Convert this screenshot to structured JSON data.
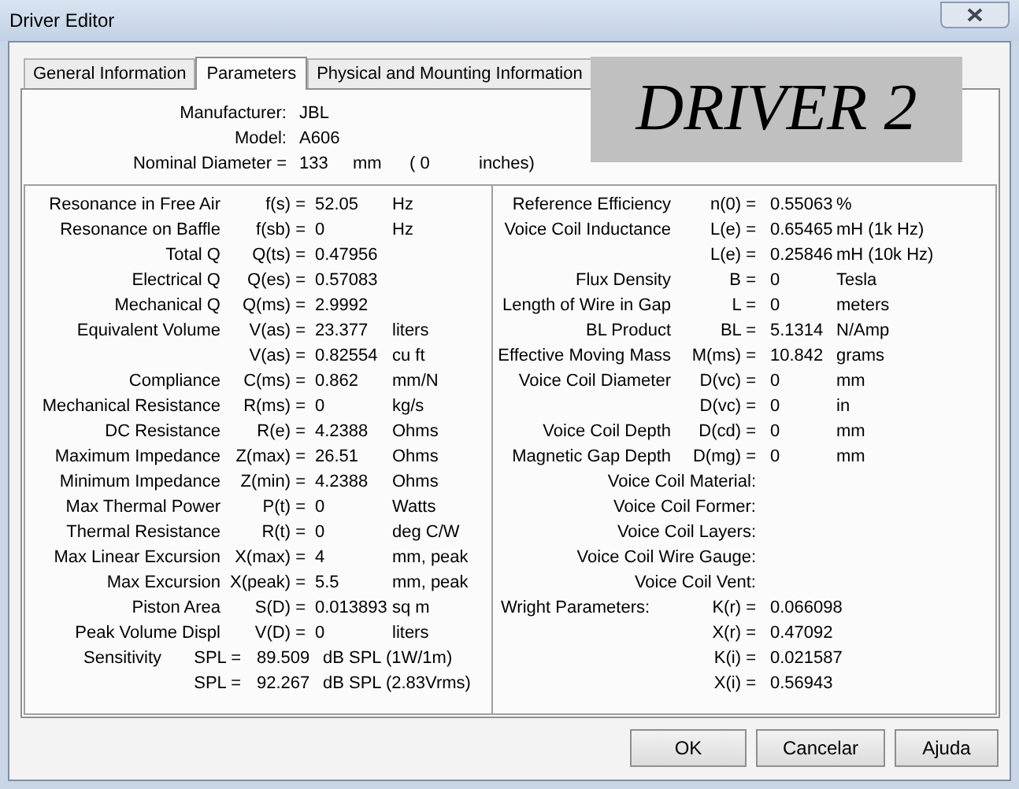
{
  "window": {
    "title": "Driver Editor"
  },
  "tabs": [
    {
      "label": "General Information",
      "selected": false
    },
    {
      "label": "Parameters",
      "selected": true
    },
    {
      "label": "Physical and Mounting Information",
      "selected": false
    }
  ],
  "banner": "DRIVER 2",
  "header": {
    "fields": [
      {
        "label": "Manufacturer:",
        "value": "JBL"
      },
      {
        "label": "Model:",
        "value": "A606"
      }
    ],
    "diameter": {
      "label": "Nominal Diameter =",
      "value": "133",
      "unit": "mm",
      "inches_value": "( 0",
      "inches_unit": "inches)"
    }
  },
  "left": [
    {
      "kind": "param",
      "label": "Resonance in Free Air",
      "symbol": "f(s) =",
      "value": "52.05",
      "unit": "Hz"
    },
    {
      "kind": "param",
      "label": "Resonance on Baffle",
      "symbol": "f(sb) =",
      "value": "0",
      "unit": "Hz"
    },
    {
      "kind": "param",
      "label": "Total Q",
      "symbol": "Q(ts) =",
      "value": "0.47956"
    },
    {
      "kind": "param",
      "label": "Electrical Q",
      "symbol": "Q(es) =",
      "value": "0.57083"
    },
    {
      "kind": "param",
      "label": "Mechanical Q",
      "symbol": "Q(ms) =",
      "value": "2.9992"
    },
    {
      "kind": "param",
      "label": "Equivalent Volume",
      "symbol": "V(as) =",
      "value": "23.377",
      "unit": "liters"
    },
    {
      "kind": "param",
      "symbol": "V(as) =",
      "value": "0.82554",
      "unit": "cu ft"
    },
    {
      "kind": "param",
      "label": "Compliance",
      "symbol": "C(ms) =",
      "value": "0.862",
      "unit": "mm/N"
    },
    {
      "kind": "param",
      "label": "Mechanical Resistance",
      "symbol": "R(ms) =",
      "value": "0",
      "unit": "kg/s"
    },
    {
      "kind": "param",
      "label": "DC Resistance",
      "symbol": "R(e) =",
      "value": "4.2388",
      "unit": "Ohms"
    },
    {
      "kind": "param",
      "label": "Maximum Impedance",
      "symbol": "Z(max) =",
      "value": "26.51",
      "unit": "Ohms"
    },
    {
      "kind": "param",
      "label": "Minimum Impedance",
      "symbol": "Z(min) =",
      "value": "4.2388",
      "unit": "Ohms"
    },
    {
      "kind": "param",
      "label": "Max Thermal Power",
      "symbol": "P(t) =",
      "value": "0",
      "unit": "Watts"
    },
    {
      "kind": "param",
      "label": "Thermal Resistance",
      "symbol": "R(t) =",
      "value": "0",
      "unit": "deg C/W"
    },
    {
      "kind": "param",
      "label": "Max Linear Excursion",
      "symbol": "X(max) =",
      "value": "4",
      "unit": "mm, peak"
    },
    {
      "kind": "param",
      "label": "Max Excursion",
      "symbol": "X(peak) =",
      "value": "5.5",
      "unit": "mm, peak"
    },
    {
      "kind": "param",
      "label": "Piston Area",
      "symbol": "S(D) =",
      "value": "0.013893",
      "unit": "sq m"
    },
    {
      "kind": "param",
      "label": "Peak Volume Displ",
      "symbol": "V(D) =",
      "value": "0",
      "unit": "liters"
    },
    {
      "kind": "spl",
      "label": "Sensitivity",
      "symbol": "SPL =",
      "value": "89.509",
      "unit": "dB SPL (1W/1m)"
    },
    {
      "kind": "spl",
      "symbol": "SPL =",
      "value": "92.267",
      "unit": "dB SPL (2.83Vrms)"
    }
  ],
  "right": [
    {
      "kind": "param",
      "label": "Reference Efficiency",
      "symbol": "n(0) =",
      "value": "0.55063",
      "unit": "%"
    },
    {
      "kind": "param",
      "label": "Voice Coil Inductance",
      "symbol": "L(e) =",
      "value": "0.65465",
      "unit": "mH (1k Hz)"
    },
    {
      "kind": "param",
      "symbol": "L(e) =",
      "value": "0.25846",
      "unit": "mH (10k Hz)"
    },
    {
      "kind": "param",
      "label": "Flux Density",
      "symbol": "B =",
      "value": "0",
      "unit": "Tesla"
    },
    {
      "kind": "param",
      "label": "Length of Wire in Gap",
      "symbol": "L =",
      "value": "0",
      "unit": "meters"
    },
    {
      "kind": "param",
      "label": "BL Product",
      "symbol": "BL =",
      "value": "5.1314",
      "unit": "N/Amp"
    },
    {
      "kind": "param",
      "label": "Effective Moving Mass",
      "symbol": "M(ms) =",
      "value": "10.842",
      "unit": "grams"
    },
    {
      "kind": "param",
      "label": "Voice Coil Diameter",
      "symbol": "D(vc) =",
      "value": "0",
      "unit": "mm"
    },
    {
      "kind": "param",
      "symbol": "D(vc) =",
      "value": "0",
      "unit": "in"
    },
    {
      "kind": "param",
      "label": "Voice Coil Depth",
      "symbol": "D(cd) =",
      "value": "0",
      "unit": "mm"
    },
    {
      "kind": "param",
      "label": "Magnetic Gap Depth",
      "symbol": "D(mg) =",
      "value": "0",
      "unit": "mm"
    },
    {
      "kind": "field",
      "label": "Voice Coil Material:"
    },
    {
      "kind": "field",
      "label": "Voice Coil Former:"
    },
    {
      "kind": "field",
      "label": "Voice Coil Layers:"
    },
    {
      "kind": "field",
      "label": "Voice Coil Wire Gauge:"
    },
    {
      "kind": "field",
      "label": "Voice Coil Vent:"
    },
    {
      "kind": "wright",
      "label": "Wright Parameters:",
      "symbol": "K(r) =",
      "value": "0.066098"
    },
    {
      "kind": "wright",
      "symbol": "X(r) =",
      "value": "0.47092"
    },
    {
      "kind": "wright",
      "symbol": "K(i) =",
      "value": "0.021587"
    },
    {
      "kind": "wright",
      "symbol": "X(i) =",
      "value": "0.56943"
    }
  ],
  "buttons": [
    "OK",
    "Cancelar",
    "Ajuda"
  ]
}
